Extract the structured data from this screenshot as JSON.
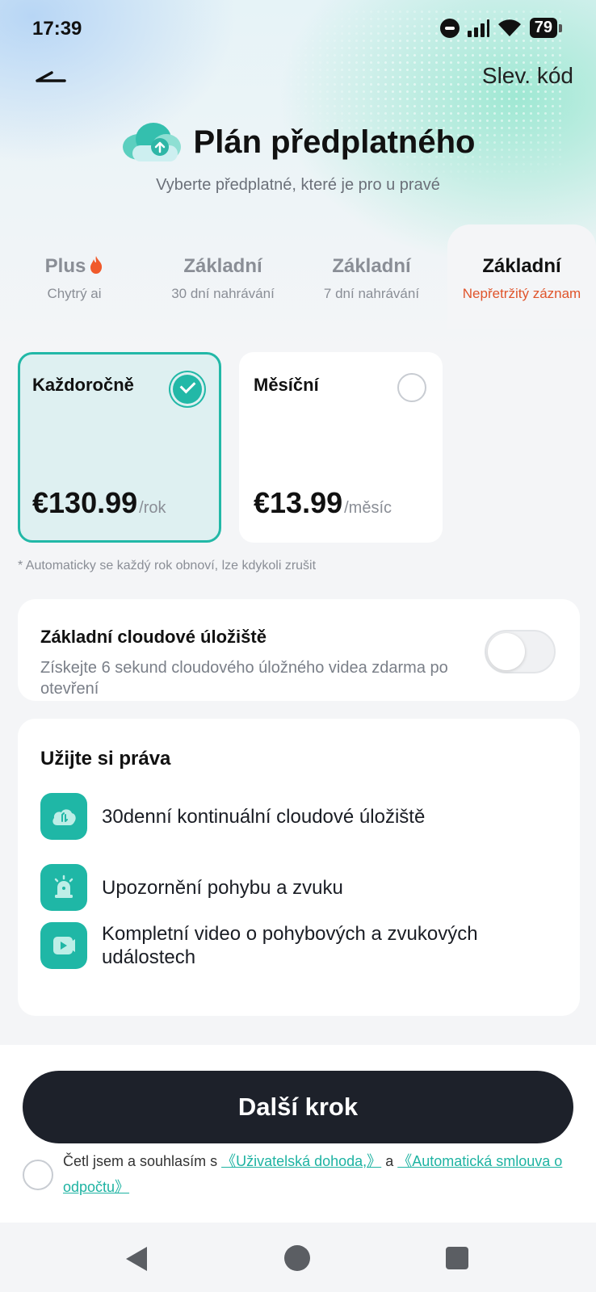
{
  "status_bar": {
    "time": "17:39",
    "battery": "79"
  },
  "header": {
    "promo_code": "Slev. kód",
    "title": "Plán předplatného",
    "subtitle": "Vyberte předplatné, které je pro u pravé"
  },
  "plans": [
    {
      "name": "Plus",
      "sub": "Chytrý ai",
      "active": false
    },
    {
      "name": "Základní",
      "sub": "30 dní nahrávání",
      "active": false
    },
    {
      "name": "Základní",
      "sub": "7 dní nahrávání",
      "active": false
    },
    {
      "name": "Základní",
      "sub": "Nepřetržitý záznam",
      "active": true
    }
  ],
  "billing": [
    {
      "label": "Každoročně",
      "price": "€130.99",
      "unit": "/rok",
      "selected": true
    },
    {
      "label": "Měsíční",
      "price": "€13.99",
      "unit": "/měsíc",
      "selected": false
    }
  ],
  "auto_renew_note": "* Automaticky se každý rok obnoví, lze kdykoli zrušit",
  "storage": {
    "title": "Základní cloudové úložiště",
    "desc": "Získejte 6 sekund cloudového úložného videa zdarma po otevření",
    "enabled": false
  },
  "benefits": {
    "title": "Užijte si práva",
    "items": [
      {
        "icon": "cloud-storage-icon",
        "text": "30denní kontinuální cloudové úložiště"
      },
      {
        "icon": "alarm-icon",
        "text": "Upozornění pohybu a zvuku"
      },
      {
        "icon": "video-play-icon",
        "text": "Kompletní video o pohybových a zvukových událostech"
      }
    ]
  },
  "footer": {
    "next_button": "Další krok",
    "agree_prefix": "Četl jsem a souhlasím s ",
    "user_agreement": "《Uživatelská dohoda,》",
    "and": " a ",
    "auto_deduct": "《Automatická smlouva o odpočtu》"
  },
  "colors": {
    "accent": "#22b8a7",
    "highlight": "#e0542b",
    "button": "#1d212a"
  }
}
